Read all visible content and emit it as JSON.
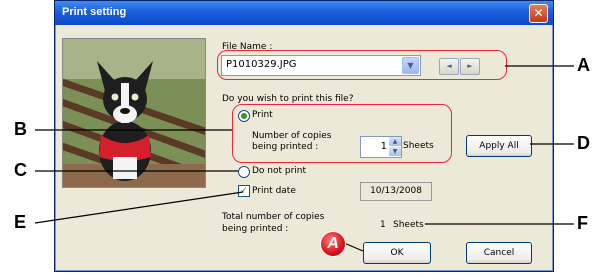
{
  "window": {
    "title": "Print setting",
    "close_glyph": "✕"
  },
  "file_name": {
    "label": "File Name :",
    "value": "P1010329.JPG",
    "prev_glyph": "◄",
    "next_glyph": "►",
    "dropdown_glyph": "▼"
  },
  "prompt": "Do you wish to print this file?",
  "print_option": {
    "label": "Print",
    "selected": true
  },
  "copies": {
    "label_line1": "Number of copies",
    "label_line2": "being printed :",
    "value": "1",
    "unit": "Sheets",
    "up_glyph": "▲",
    "down_glyph": "▼"
  },
  "apply_all_label": "Apply All",
  "do_not_print": {
    "label": "Do not print",
    "selected": false
  },
  "print_date": {
    "label": "Print date",
    "checked": true,
    "check_glyph": "✓",
    "value": "10/13/2008"
  },
  "total": {
    "label_line1": "Total number of copies",
    "label_line2": "being printed :",
    "value": "1",
    "unit": "Sheets"
  },
  "buttons": {
    "ok": "OK",
    "cancel": "Cancel"
  },
  "callouts": {
    "a": "A",
    "b": "B",
    "c": "C",
    "d": "D",
    "e": "E",
    "f": "F",
    "ok_badge": "A"
  },
  "colors": {
    "annotation": "#e8283c",
    "title_bar": "#1b5fdc",
    "dialog_bg": "#ece9d8"
  },
  "icons": [
    "close-icon",
    "dropdown-arrow-icon",
    "prev-arrow-icon",
    "next-arrow-icon",
    "radio-icon",
    "checkbox-icon",
    "spin-up-icon",
    "spin-down-icon"
  ]
}
